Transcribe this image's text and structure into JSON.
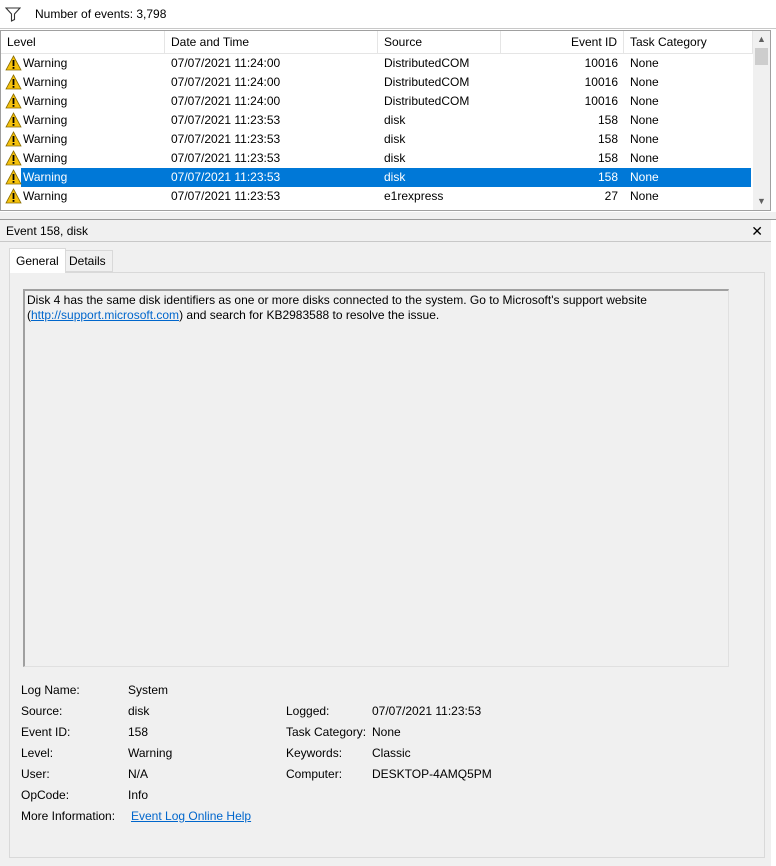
{
  "toolbar": {
    "filter_icon": "filter-funnel-icon",
    "event_count_text": "Number of events: 3,798"
  },
  "grid": {
    "columns": [
      "Level",
      "Date and Time",
      "Source",
      "Event ID",
      "Task Category"
    ],
    "rows": [
      {
        "level": "Warning",
        "datetime": "07/07/2021 11:24:00",
        "source": "DistributedCOM",
        "event_id": "10016",
        "task_category": "None",
        "selected": false
      },
      {
        "level": "Warning",
        "datetime": "07/07/2021 11:24:00",
        "source": "DistributedCOM",
        "event_id": "10016",
        "task_category": "None",
        "selected": false
      },
      {
        "level": "Warning",
        "datetime": "07/07/2021 11:24:00",
        "source": "DistributedCOM",
        "event_id": "10016",
        "task_category": "None",
        "selected": false
      },
      {
        "level": "Warning",
        "datetime": "07/07/2021 11:23:53",
        "source": "disk",
        "event_id": "158",
        "task_category": "None",
        "selected": false
      },
      {
        "level": "Warning",
        "datetime": "07/07/2021 11:23:53",
        "source": "disk",
        "event_id": "158",
        "task_category": "None",
        "selected": false
      },
      {
        "level": "Warning",
        "datetime": "07/07/2021 11:23:53",
        "source": "disk",
        "event_id": "158",
        "task_category": "None",
        "selected": false
      },
      {
        "level": "Warning",
        "datetime": "07/07/2021 11:23:53",
        "source": "disk",
        "event_id": "158",
        "task_category": "None",
        "selected": true
      },
      {
        "level": "Warning",
        "datetime": "07/07/2021 11:23:53",
        "source": "e1rexpress",
        "event_id": "27",
        "task_category": "None",
        "selected": false
      }
    ],
    "level_icon": "warning-triangle-icon",
    "selection_color": "#0078d7"
  },
  "detail": {
    "title": "Event 158, disk",
    "close_glyph": "✕",
    "tabs": [
      "General",
      "Details"
    ],
    "active_tab": "General",
    "description_part1": "Disk 4 has the same disk identifiers as one or more disks connected to the system. Go to Microsoft's support website (",
    "description_link": "http://support.microsoft.com",
    "description_part2": ") and search for KB2983588 to resolve the issue.",
    "props": {
      "log_name_label": "Log Name:",
      "log_name_value": "System",
      "source_label": "Source:",
      "source_value": "disk",
      "event_id_label": "Event ID:",
      "event_id_value": "158",
      "level_label": "Level:",
      "level_value": "Warning",
      "user_label": "User:",
      "user_value": "N/A",
      "opcode_label": "OpCode:",
      "opcode_value": "Info",
      "more_info_label": "More Information:",
      "more_info_link": "Event Log Online Help",
      "logged_label": "Logged:",
      "logged_value": "07/07/2021 11:23:53",
      "task_category_label": "Task Category:",
      "task_category_value": "None",
      "keywords_label": "Keywords:",
      "keywords_value": "Classic",
      "computer_label": "Computer:",
      "computer_value": "DESKTOP-4AMQ5PM"
    }
  }
}
